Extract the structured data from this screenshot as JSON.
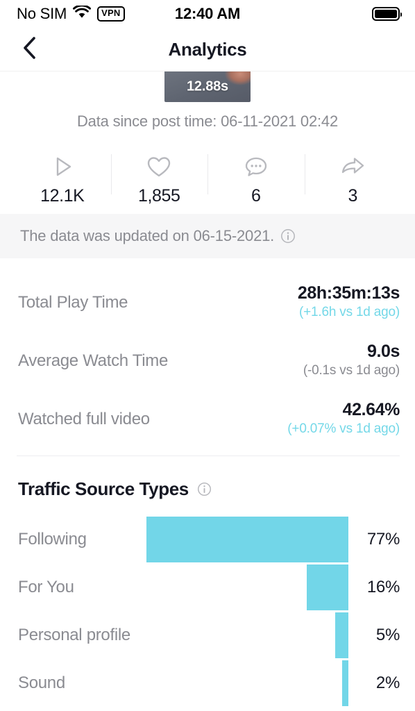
{
  "status_bar": {
    "carrier": "No SIM",
    "wifi_icon": "wifi-icon",
    "vpn_label": "VPN",
    "time": "12:40 AM",
    "battery_icon": "battery-icon"
  },
  "nav": {
    "back_icon": "chevron-left-icon",
    "title": "Analytics"
  },
  "video": {
    "duration": "12.88s",
    "post_time": "Data since post time: 06-11-2021 02:42"
  },
  "engagement": [
    {
      "icon": "play-icon",
      "value": "12.1K"
    },
    {
      "icon": "heart-icon",
      "value": "1,855"
    },
    {
      "icon": "comment-icon",
      "value": "6"
    },
    {
      "icon": "share-icon",
      "value": "3"
    }
  ],
  "update_banner": {
    "text": "The data was updated on 06-15-2021.",
    "info_icon": "info-circle-icon"
  },
  "metrics": [
    {
      "label": "Total Play Time",
      "value": "28h:35m:13s",
      "delta": "(+1.6h vs 1d ago)",
      "direction": "up"
    },
    {
      "label": "Average Watch Time",
      "value": "9.0s",
      "delta": "(-0.1s vs 1d ago)",
      "direction": "down"
    },
    {
      "label": "Watched full video",
      "value": "42.64%",
      "delta": "(+0.07% vs 1d ago)",
      "direction": "up"
    }
  ],
  "traffic": {
    "title": "Traffic Source Types",
    "info_icon": "info-circle-icon"
  },
  "colors": {
    "accent": "#72d6e8",
    "text_primary": "#161823",
    "text_secondary": "#8a8b91",
    "banner_bg": "#f6f6f7"
  },
  "chart_data": {
    "type": "bar",
    "title": "Traffic Source Types",
    "orientation": "horizontal",
    "categories": [
      "Following",
      "For You",
      "Personal profile",
      "Sound"
    ],
    "values": [
      77,
      16,
      5,
      2
    ],
    "value_labels": [
      "77%",
      "16%",
      "5%",
      "2%"
    ],
    "xlabel": "",
    "ylabel": "",
    "xlim": [
      0,
      100
    ],
    "grid": false,
    "legend": "none",
    "bar_color": "#72d6e8",
    "note": "Bars are right-aligned; widths scale with percentage. Sound bar is clipped at the bottom of the viewport."
  }
}
